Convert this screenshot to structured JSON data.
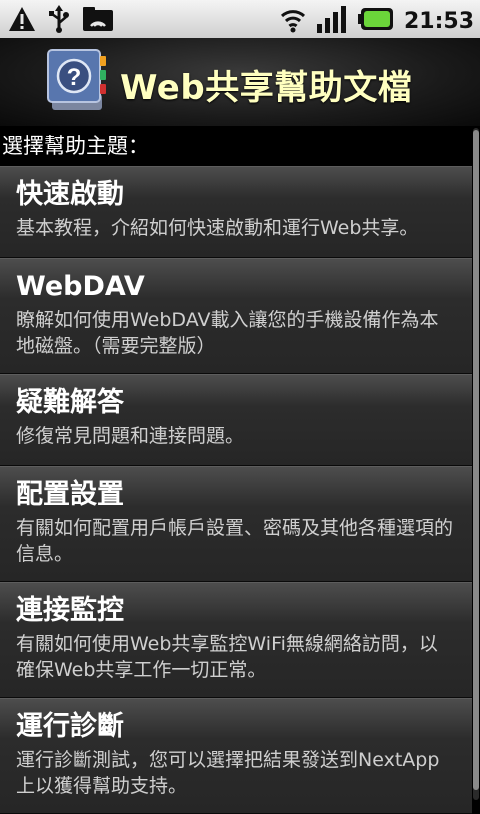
{
  "status": {
    "time": "21:53",
    "icons_left": [
      "warning-icon",
      "usb-icon",
      "wifi-folder-icon"
    ],
    "icons_right": [
      "wifi-icon",
      "signal-icon",
      "battery-icon"
    ],
    "battery_color": "#6bd53a"
  },
  "header": {
    "title": "Web共享幫助文檔",
    "title_color": "#ffffc0"
  },
  "prompt": "選擇幫助主題：",
  "items": [
    {
      "title": "快速啟動",
      "desc": "基本教程，介紹如何快速啟動和運行Web共享。"
    },
    {
      "title": "WebDAV",
      "desc": "瞭解如何使用WebDAV載入讓您的手機設備作為本地磁盤。（需要完整版）"
    },
    {
      "title": "疑難解答",
      "desc": "修復常見問題和連接問題。"
    },
    {
      "title": "配置設置",
      "desc": "有關如何配置用戶帳戶設置、密碼及其他各種選項的信息。"
    },
    {
      "title": "連接監控",
      "desc": "有關如何使用Web共享監控WiFi無線網絡訪問，以確保Web共享工作一切正常。"
    },
    {
      "title": "運行診斷",
      "desc": "運行診斷測試，您可以選擇把結果發送到NextApp上以獲得幫助支持。"
    }
  ]
}
